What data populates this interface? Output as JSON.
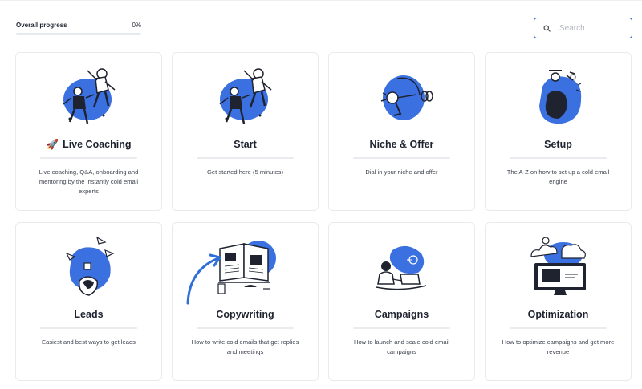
{
  "progress": {
    "label": "Overall progress",
    "value_text": "0%",
    "fraction": 0
  },
  "search": {
    "placeholder": "Search",
    "value": ""
  },
  "colors": {
    "accent": "#3b6fe0",
    "illustration_blue": "#3a70e0",
    "ink": "#1f2330"
  },
  "cards": [
    {
      "title": "Live Coaching",
      "prefix_icon": "rocket-icon",
      "description": "Live coaching, Q&A, onboarding and mentoring by the Instantly cold email experts",
      "illustration": "dancing-people-illustration"
    },
    {
      "title": "Start",
      "description": "Get started here (5 minutes)",
      "illustration": "dancing-people-illustration"
    },
    {
      "title": "Niche & Offer",
      "description": "Dial in your niche and offer",
      "illustration": "archer-illustration"
    },
    {
      "title": "Setup",
      "description": "The A-Z on how to set up a cold email engine",
      "illustration": "person-setup-illustration"
    },
    {
      "title": "Leads",
      "description": "Easiest and best ways to get leads",
      "illustration": "person-paper-planes-illustration"
    },
    {
      "title": "Copywriting",
      "description": "How to write cold emails that get replies and meetings",
      "illustration": "open-book-illustration"
    },
    {
      "title": "Campaigns",
      "description": "How to launch and scale cold email campaigns",
      "illustration": "person-laptop-illustration"
    },
    {
      "title": "Optimization",
      "description": "How to optimize campaigns and get more revenue",
      "illustration": "monitor-clouds-illustration"
    }
  ]
}
